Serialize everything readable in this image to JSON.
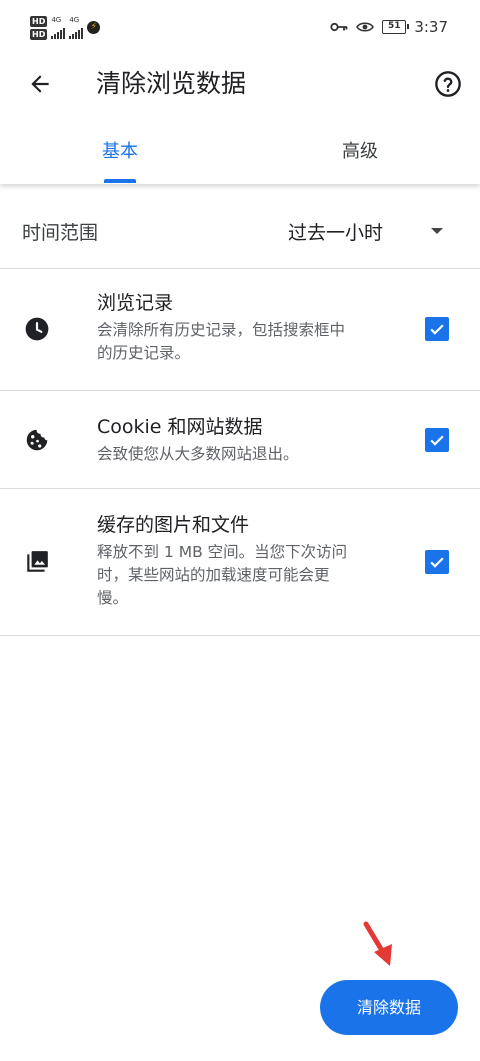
{
  "status_bar": {
    "hd_1": "HD",
    "hd_2": "HD",
    "net_1": "4G",
    "net_2": "4G",
    "battery": "51",
    "time": "3:37"
  },
  "app_bar": {
    "title": "清除浏览数据",
    "back_icon": "arrow-left-icon",
    "help_icon": "help-circle-icon"
  },
  "tabs": [
    {
      "label": "基本",
      "selected": true
    },
    {
      "label": "高级",
      "selected": false
    }
  ],
  "time_range": {
    "label": "时间范围",
    "value": "过去一小时"
  },
  "items": [
    {
      "icon": "clock-icon",
      "title": "浏览记录",
      "desc_lines": [
        "会清除所有历史记录，包括搜索框中",
        "的历史记录。"
      ],
      "checked": true
    },
    {
      "icon": "cookie-icon",
      "title": "Cookie 和网站数据",
      "desc_lines": [
        "会致使您从大多数网站退出。"
      ],
      "checked": true
    },
    {
      "icon": "image-icon",
      "title": "缓存的图片和文件",
      "desc_lines": [
        "释放不到 1 MB 空间。当您下次访问",
        "时，某些网站的加载速度可能会更",
        "慢。"
      ],
      "checked": true
    }
  ],
  "clear_button": {
    "label": "清除数据"
  },
  "colors": {
    "accent": "#1a73e8",
    "annotation_arrow": "#e53935"
  }
}
